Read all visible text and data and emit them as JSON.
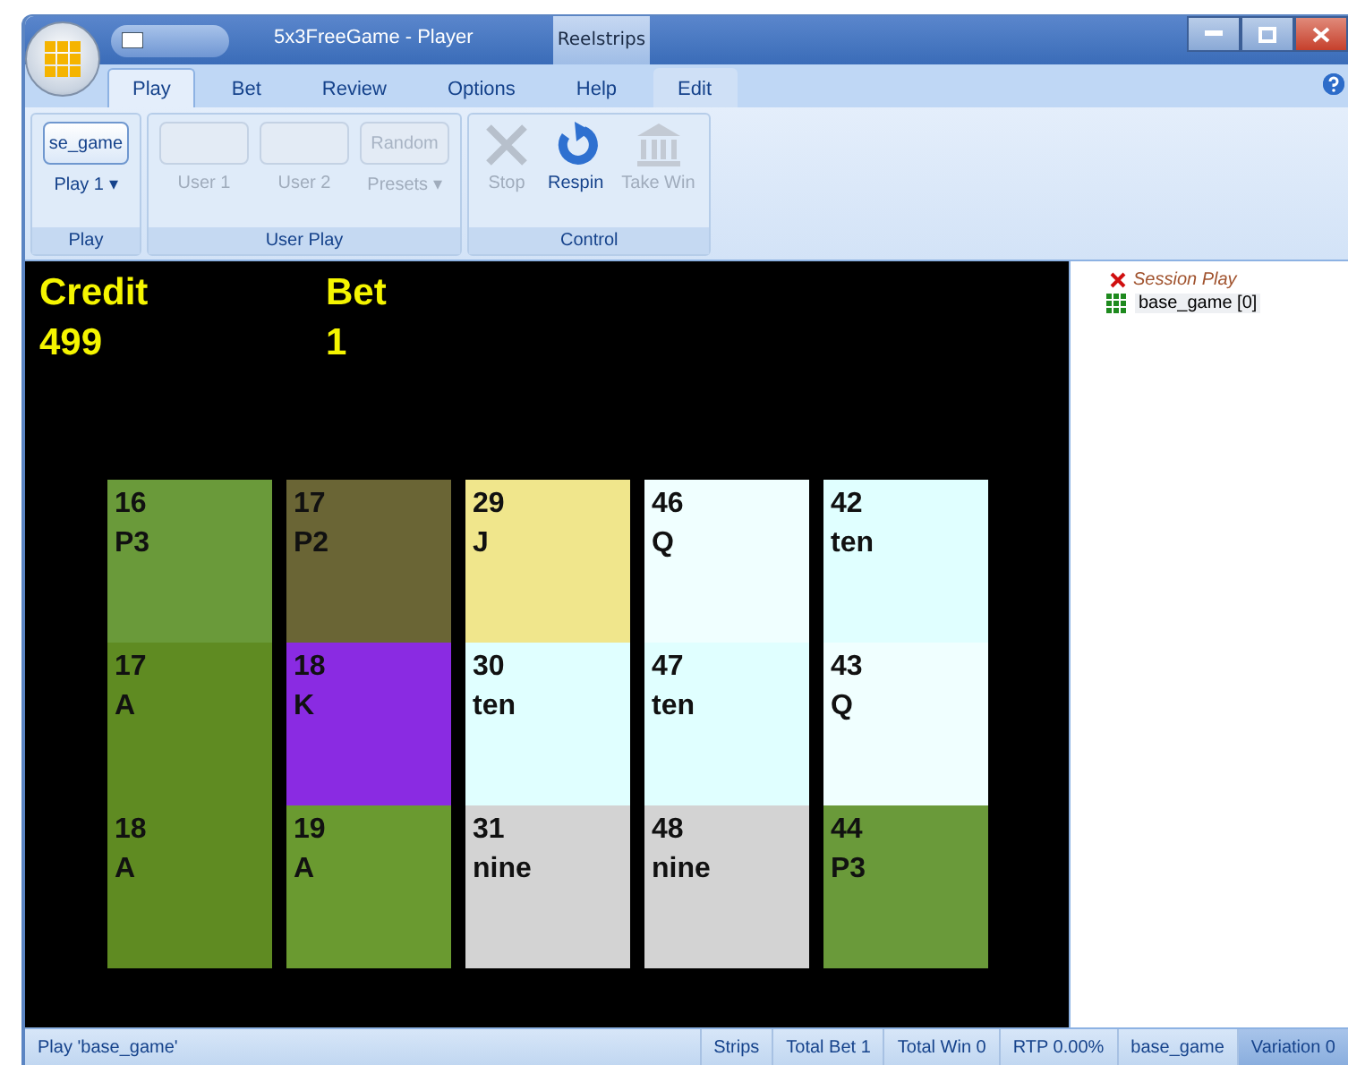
{
  "window": {
    "title": "5x3FreeGame - Player",
    "context_tab_group": "Reelstrips"
  },
  "tabs": [
    {
      "label": "Play",
      "selected": true
    },
    {
      "label": "Bet",
      "selected": false
    },
    {
      "label": "Review",
      "selected": false
    },
    {
      "label": "Options",
      "selected": false
    },
    {
      "label": "Help",
      "selected": false
    },
    {
      "label": "Edit",
      "selected": false
    }
  ],
  "ribbon_groups": [
    {
      "title": "Play",
      "items": [
        {
          "kind": "game",
          "label": "se_game",
          "sublabel": "Play 1 ▾",
          "disabled": false
        }
      ]
    },
    {
      "title": "User Play",
      "items": [
        {
          "kind": "slot",
          "label": "User 1",
          "disabled": true
        },
        {
          "kind": "slot",
          "label": "User 2",
          "disabled": true
        },
        {
          "kind": "preset",
          "button": "Random",
          "label": "Presets ▾",
          "disabled": true
        }
      ]
    },
    {
      "title": "Control",
      "items": [
        {
          "kind": "stop",
          "label": "Stop",
          "disabled": true
        },
        {
          "kind": "respin",
          "label": "Respin",
          "disabled": false
        },
        {
          "kind": "takewin",
          "label": "Take Win",
          "disabled": true
        }
      ]
    }
  ],
  "game": {
    "credit_label": "Credit",
    "credit": "499",
    "bet_label": "Bet",
    "bet": "1",
    "reels": [
      [
        {
          "number": "16",
          "symbol": "P3",
          "color": "#6a9a3a"
        },
        {
          "number": "17",
          "symbol": "A",
          "color": "#5f8b22"
        },
        {
          "number": "18",
          "symbol": "A",
          "color": "#5f8b22"
        }
      ],
      [
        {
          "number": "17",
          "symbol": "P2",
          "color": "#6a6535"
        },
        {
          "number": "18",
          "symbol": "K",
          "color": "#8a2be2"
        },
        {
          "number": "19",
          "symbol": "A",
          "color": "#6a9a30"
        }
      ],
      [
        {
          "number": "29",
          "symbol": "J",
          "color": "#f0e68c"
        },
        {
          "number": "30",
          "symbol": "ten",
          "color": "#e0ffff"
        },
        {
          "number": "31",
          "symbol": "nine",
          "color": "#d3d3d3"
        }
      ],
      [
        {
          "number": "46",
          "symbol": "Q",
          "color": "#f0ffff"
        },
        {
          "number": "47",
          "symbol": "ten",
          "color": "#e0ffff"
        },
        {
          "number": "48",
          "symbol": "nine",
          "color": "#d3d3d3"
        }
      ],
      [
        {
          "number": "42",
          "symbol": "ten",
          "color": "#e0ffff"
        },
        {
          "number": "43",
          "symbol": "Q",
          "color": "#f0ffff"
        },
        {
          "number": "44",
          "symbol": "P3",
          "color": "#6a9a3a"
        }
      ]
    ]
  },
  "tree": [
    {
      "label": "Session Play",
      "kind": "session",
      "children": [
        {
          "label": "base_game [0]",
          "kind": "game"
        }
      ]
    }
  ],
  "status_bar": [
    {
      "text": "Play 'base_game'",
      "selected": false
    },
    {
      "text": "Strips",
      "selected": false
    },
    {
      "text": "Total Bet 1",
      "selected": false
    },
    {
      "text": "Total Win 0",
      "selected": false
    },
    {
      "text": "RTP 0.00%",
      "selected": false
    },
    {
      "text": "base_game",
      "selected": false
    },
    {
      "text": "Variation 0",
      "selected": true
    }
  ]
}
